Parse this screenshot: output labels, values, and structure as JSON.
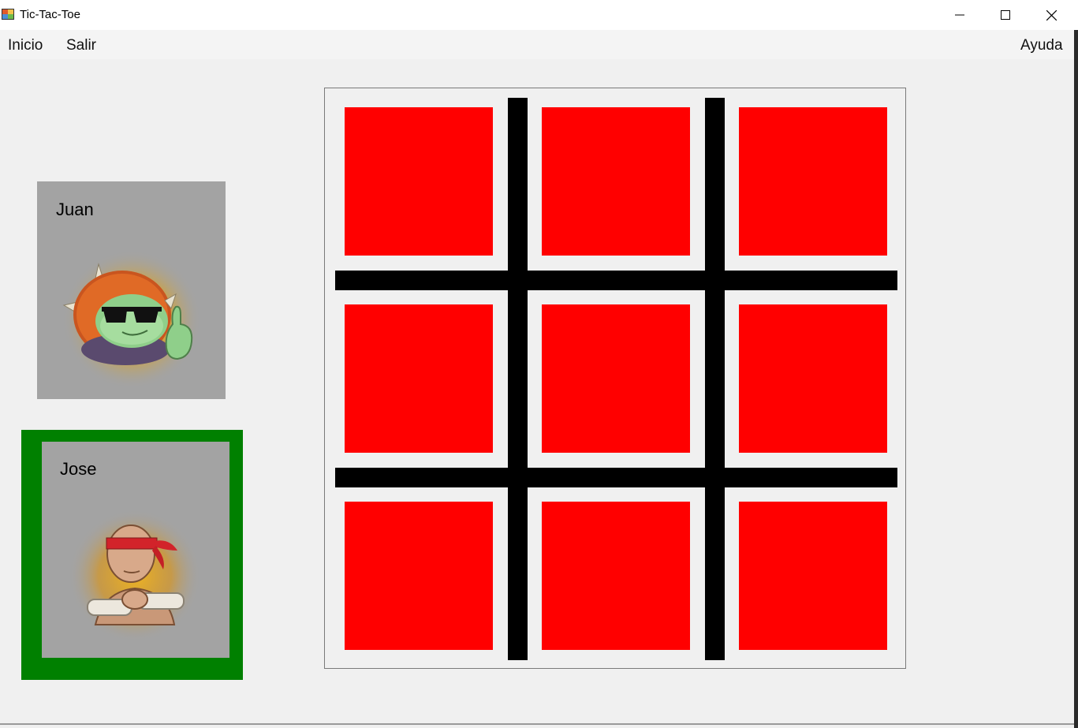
{
  "window": {
    "title": "Tic-Tac-Toe"
  },
  "menu": {
    "inicio": "Inicio",
    "salir": "Salir",
    "ayuda": "Ayuda"
  },
  "players": [
    {
      "name": "Juan",
      "active": false,
      "avatar": "turtle-with-sunglasses-thumbs-up-icon"
    },
    {
      "name": "Jose",
      "active": true,
      "avatar": "blindfolded-monk-icon"
    }
  ],
  "colors": {
    "cell": "#ff0000",
    "grid": "#000000",
    "active_player": "#008000",
    "card_background": "#a3a3a3"
  },
  "board": {
    "cells": [
      "",
      "",
      "",
      "",
      "",
      "",
      "",
      "",
      ""
    ]
  }
}
